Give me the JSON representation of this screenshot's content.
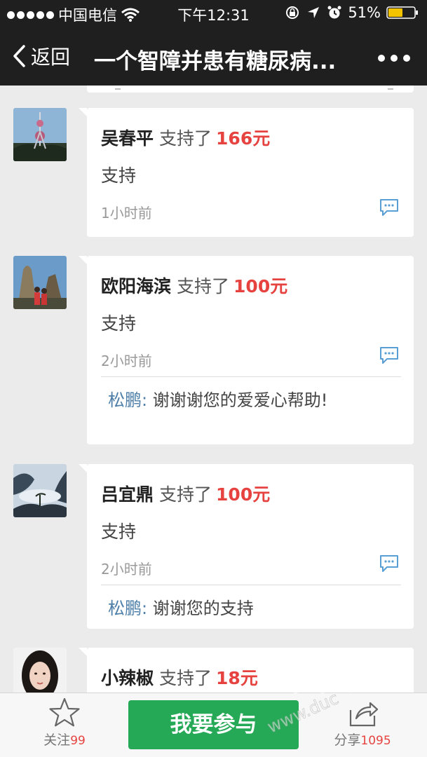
{
  "status_bar": {
    "carrier": "中国电信",
    "time": "下午12:31",
    "battery": "51%"
  },
  "nav": {
    "back_label": "返回",
    "title": "一个智障并患有糖尿病..."
  },
  "entries": [
    {
      "name": "吴春平",
      "verb": "支持了",
      "amount": "166元",
      "message": "支持",
      "time": "1小时前",
      "avatar": "tower-photo"
    },
    {
      "name": "欧阳海滨",
      "verb": "支持了",
      "amount": "100元",
      "message": "支持",
      "time": "2小时前",
      "avatar": "mountain-couple-photo",
      "reply": {
        "name": "松鹏:",
        "text": "谢谢谢您的爱爱心帮助!"
      }
    },
    {
      "name": "吕宜鼎",
      "verb": "支持了",
      "amount": "100元",
      "message": "支持",
      "time": "2小时前",
      "avatar": "misty-mountain-photo",
      "reply": {
        "name": "松鹏:",
        "text": "谢谢您的支持"
      }
    },
    {
      "name": "小辣椒",
      "verb": "支持了",
      "amount": "18元",
      "avatar": "woman-portrait-photo"
    }
  ],
  "bottom_bar": {
    "follow_label": "关注",
    "follow_count": "99",
    "join_label": "我要参与",
    "share_label": "分享",
    "share_count": "1095"
  },
  "watermark": {
    "text": "www.duc"
  },
  "colors": {
    "amount": "#e64340",
    "reply_name": "#4e7fa8",
    "primary_button": "#26a956",
    "nav_background": "#1f1f1f"
  }
}
